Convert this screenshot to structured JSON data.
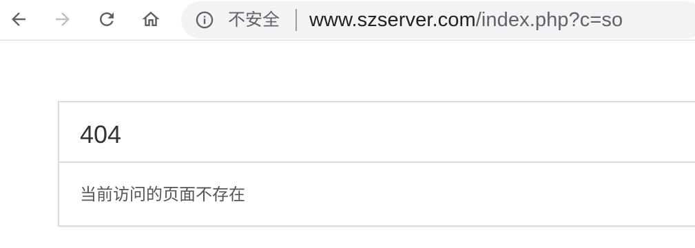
{
  "browser": {
    "nav": {
      "back_icon": "arrow-left-icon",
      "forward_icon": "arrow-right-icon",
      "reload_icon": "reload-icon",
      "home_icon": "home-icon"
    },
    "address_bar": {
      "security_icon": "info-icon",
      "security_label": "不安全",
      "url_host": "www.szserver.com",
      "url_path": "/index.php?c=so"
    },
    "colors": {
      "toolbar_bg": "#ffffff",
      "omnibox_bg": "#f1f3f4",
      "icon_active": "#5f6368",
      "icon_disabled": "#bdc1c6",
      "url_host": "#202124",
      "url_path": "#5f6368"
    }
  },
  "page": {
    "panel": {
      "title": "404",
      "message": "当前访问的页面不存在"
    },
    "colors": {
      "panel_border": "#dcdcdc",
      "title_text": "#333333",
      "message_text": "#555555"
    }
  }
}
